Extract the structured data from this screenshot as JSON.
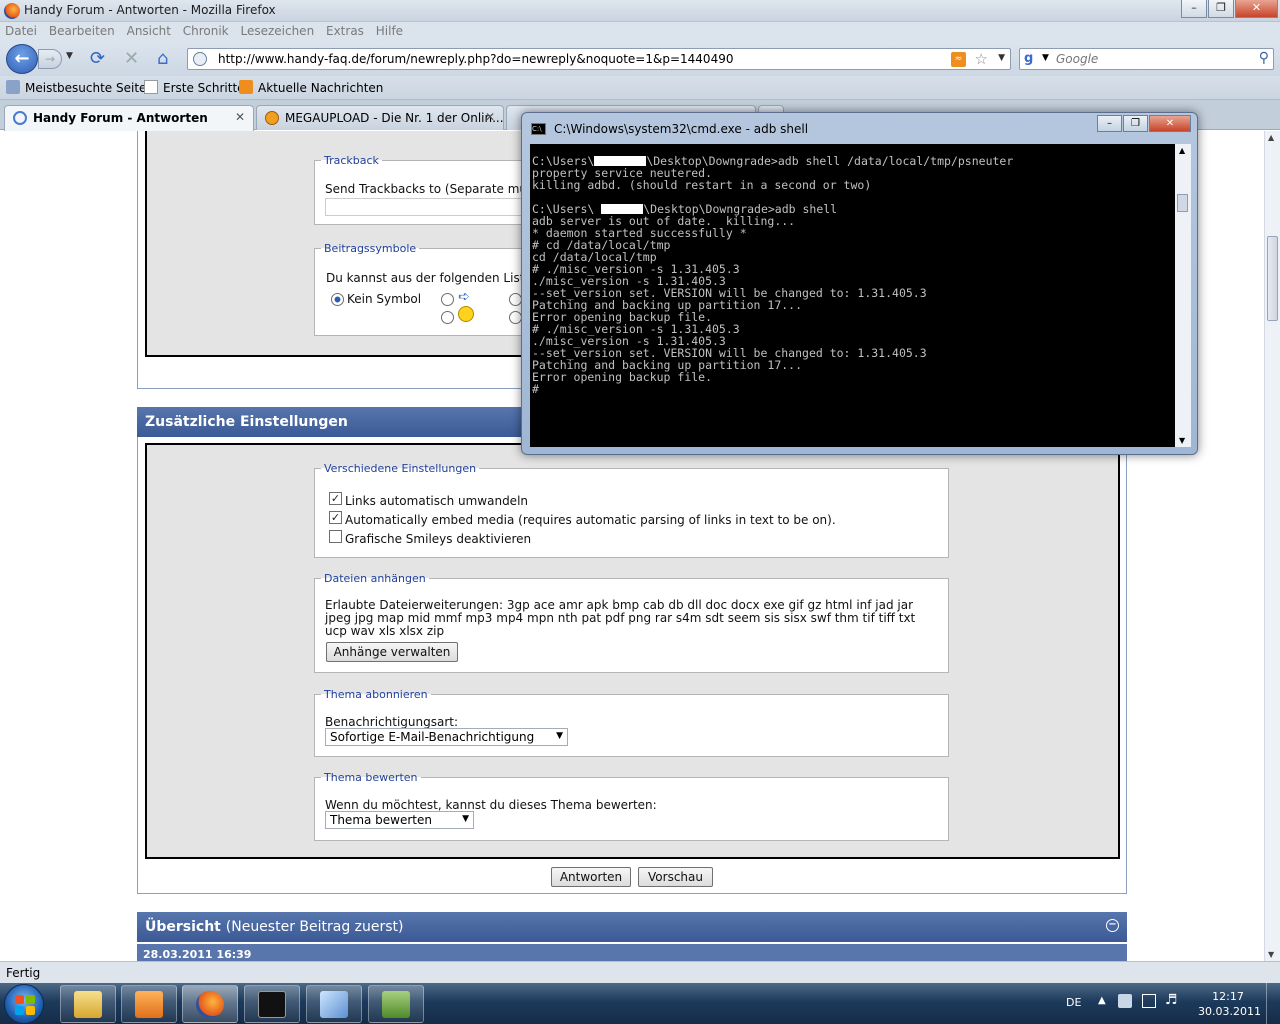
{
  "browser": {
    "window_title": "Handy Forum - Antworten - Mozilla Firefox",
    "menu": [
      "Datei",
      "Bearbeiten",
      "Ansicht",
      "Chronik",
      "Lesezeichen",
      "Extras",
      "Hilfe"
    ],
    "url": "http://www.handy-faq.de/forum/newreply.php?do=newreply&noquote=1&p=1440490",
    "search_placeholder": "Google",
    "bookmarks": [
      "Meistbesuchte Seiten",
      "Erste Schritte",
      "Aktuelle Nachrichten"
    ],
    "tabs": [
      {
        "label": "Handy Forum - Antworten",
        "active": true
      },
      {
        "label": "MEGAUPLOAD - Die Nr. 1 der Onlin...",
        "active": false
      }
    ],
    "status": "Fertig"
  },
  "forum": {
    "trackback": {
      "legend": "Trackback",
      "label": "Send Trackbacks to (Separate mu"
    },
    "symbols": {
      "legend": "Beitragssymbole",
      "intro": "Du kannst aus der folgenden Liste",
      "none_label": "Kein Symbol"
    },
    "additional": {
      "heading": "Zusätzliche Einstellungen",
      "misc": {
        "legend": "Verschiedene Einstellungen",
        "options": [
          {
            "label": "Links automatisch umwandeln",
            "checked": true
          },
          {
            "label": "Automatically embed media (requires automatic parsing of links in text to be on).",
            "checked": true
          },
          {
            "label": "Grafische Smileys deaktivieren",
            "checked": false
          }
        ]
      },
      "attachments": {
        "legend": "Dateien anhängen",
        "text": "Erlaubte Dateierweiterungen: 3gp ace amr apk bmp cab db dll doc docx exe gif gz html inf jad jar jpeg jpg map mid mmf mp3 mp4 mpn nth pat pdf png rar s4m sdt seem sis sisx swf thm tif tiff txt ucp wav xls xlsx zip",
        "button": "Anhänge verwalten"
      },
      "subscribe": {
        "legend": "Thema abonnieren",
        "label": "Benachrichtigungsart:",
        "selected": "Sofortige E-Mail-Benachrichtigung"
      },
      "rate": {
        "legend": "Thema bewerten",
        "label": "Wenn du möchtest, kannst du dieses Thema bewerten:",
        "selected": "Thema bewerten"
      }
    },
    "buttons": {
      "reply": "Antworten",
      "preview": "Vorschau"
    },
    "overview": {
      "heading": "Übersicht",
      "sub": "(Neuester Beitrag zuerst)",
      "date": "28.03.2011 16:39"
    }
  },
  "cmd": {
    "title": "C:\\Windows\\system32\\cmd.exe - adb  shell",
    "line1_prefix": "C:\\Users\\",
    "line1_suffix": "\\Desktop\\Downgrade>adb shell /data/local/tmp/psneuter",
    "block1": "property service neutered.\nkilling adbd. (should restart in a second or two)",
    "line2_prefix": "C:\\Users\\ ",
    "line2_suffix": "\\Desktop\\Downgrade>adb shell",
    "block2": "adb server is out of date.  killing...\n* daemon started successfully *\n# cd /data/local/tmp\ncd /data/local/tmp\n# ./misc_version -s 1.31.405.3\n./misc_version -s 1.31.405.3\n--set_version set. VERSION will be changed to: 1.31.405.3\nPatching and backing up partition 17...\nError opening backup file.\n# ./misc_version -s 1.31.405.3\n./misc_version -s 1.31.405.3\n--set_version set. VERSION will be changed to: 1.31.405.3\nPatching and backing up partition 17...\nError opening backup file.\n#"
  },
  "taskbar": {
    "language": "DE",
    "time": "12:17",
    "date": "30.03.2011"
  }
}
